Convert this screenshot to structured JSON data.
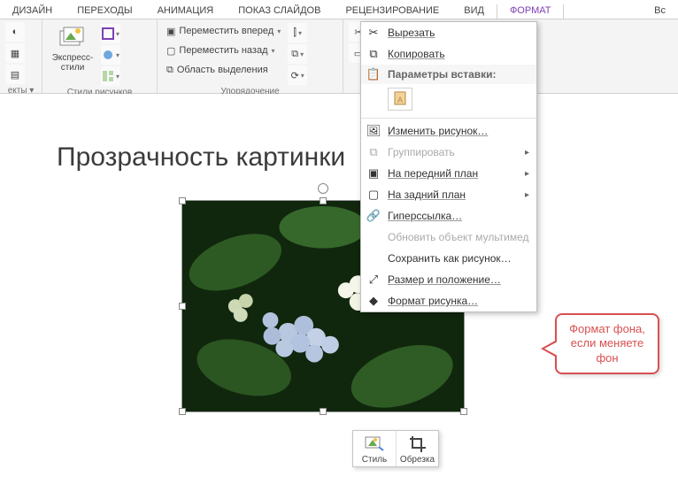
{
  "tabs": {
    "design": "ДИЗАЙН",
    "transitions": "ПЕРЕХОДЫ",
    "animation": "АНИМАЦИЯ",
    "slideshow": "ПОКАЗ СЛАЙДОВ",
    "review": "РЕЦЕНЗИРОВАНИЕ",
    "view": "ВИД",
    "format": "ФОРМАТ",
    "partial": "Вс"
  },
  "ribbon": {
    "group1_label": "екты ▾",
    "express_styles": "Экспресс-\nстили",
    "styles_group": "Стили рисунков",
    "arrange_group": "Упорядочение",
    "bring_forward": "Переместить вперед",
    "send_backward": "Переместить назад",
    "selection_pane": "Область выделения"
  },
  "slide": {
    "title": "Прозрачность картинки"
  },
  "context_menu": {
    "cut": "Вырезать",
    "copy": "Копировать",
    "paste_header": "Параметры вставки:",
    "change_picture": "Изменить рисунок…",
    "group": "Группировать",
    "bring_front": "На передний план",
    "send_back": "На задний план",
    "hyperlink": "Гиперссылка…",
    "update_media": "Обновить объект мультимед",
    "save_as_picture": "Сохранить как рисунок…",
    "size_position": "Размер и положение…",
    "format_picture": "Формат рисунка…"
  },
  "mini_toolbar": {
    "style": "Стиль",
    "crop": "Обрезка"
  },
  "callout": {
    "line1": "Формат фона,",
    "line2": "если меняете",
    "line3": "фон"
  }
}
